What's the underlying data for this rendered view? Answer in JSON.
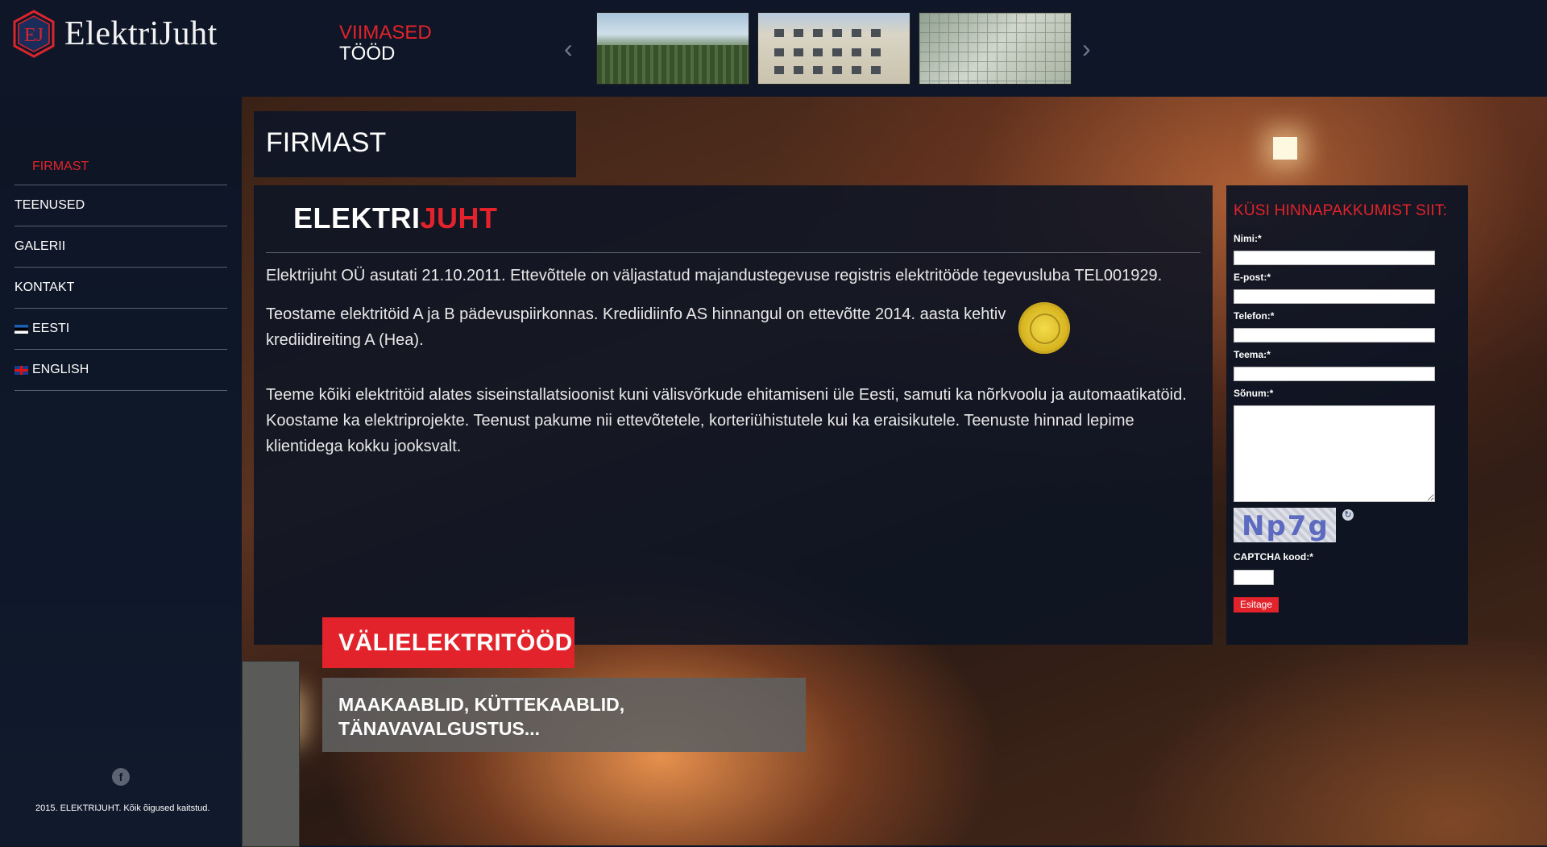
{
  "brand": {
    "name": "ElektriJuht",
    "mark_letters": "EJ"
  },
  "recent": {
    "line1": "VIIMASED",
    "line2": "TÖÖD",
    "prev": "‹",
    "next": "›"
  },
  "nav": {
    "items": [
      {
        "label": "FIRMAST",
        "active": true
      },
      {
        "label": "TEENUSED"
      },
      {
        "label": "GALERII"
      },
      {
        "label": "KONTAKT"
      },
      {
        "label": "EESTI",
        "flag": "estonia-flag-icon"
      },
      {
        "label": "ENGLISH",
        "flag": "uk-flag-icon"
      }
    ]
  },
  "footer": {
    "facebook": "f",
    "copyright": "2015. ELEKTRIJUHT. Kõik õigused kaitstud."
  },
  "page": {
    "title": "FIRMAST"
  },
  "content": {
    "heading_part1": "ELEKTRI",
    "heading_part2": "JUHT",
    "p1": "Elektrijuht OÜ asutati 21.10.2011. Ettevõttele on väljastatud majandustegevuse registris elektritööde tegevusluba TEL001929.",
    "p2": "Teostame elektritöid A ja B pädevuspiirkonnas. Krediidiinfo AS hinnangul on ettevõtte 2014. aasta kehtiv krediidireiting A (Hea).",
    "p3": "Teeme kõiki elektritöid alates siseinstallatsioonist kuni välisvõrkude ehitamiseni üle Eesti, samuti ka nõrkvoolu ja automaatikatöid. Koostame ka elektriprojekte. Teenust pakume nii ettevõtetele, korteriühistutele kui ka eraisikutele. Teenuste hinnad lepime klientidega kokku jooksvalt."
  },
  "banner": {
    "title": "VÄLIELEKTRITÖÖD",
    "subtitle_line1": "MAAKAABLID, KÜTTEKAABLID,",
    "subtitle_line2": "TÄNAVAVALGUSTUS..."
  },
  "form": {
    "title": "KÜSI HINNAPAKKUMIST SIIT:",
    "name_label": "Nimi:*",
    "email_label": "E-post:*",
    "phone_label": "Telefon:*",
    "topic_label": "Teema:*",
    "message_label": "Sõnum:*",
    "captcha_image_text": "Np7g",
    "captcha_label": "CAPTCHA kood:*",
    "submit": "Esitage"
  },
  "colors": {
    "accent": "#e3232b",
    "panel": "#0c1424",
    "banner_grey": "#5f5f5f"
  }
}
